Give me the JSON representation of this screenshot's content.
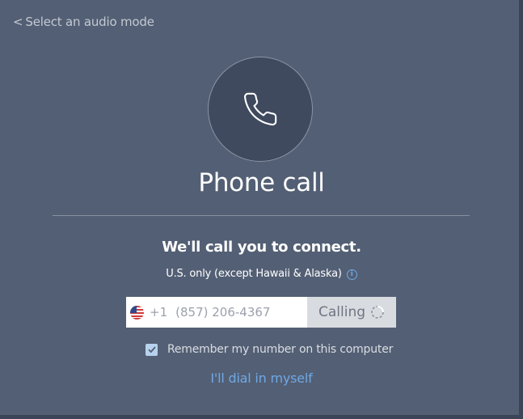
{
  "back_link": {
    "chevron": "<",
    "label": "Select an audio mode"
  },
  "hero": {
    "icon": "phone-icon",
    "title": "Phone call"
  },
  "connect": {
    "heading": "We'll call you to connect.",
    "note": "U.S. only (except Hawaii & Alaska)",
    "info_icon": "i"
  },
  "phone_input": {
    "country_flag": "us-flag-icon",
    "country_code": "+1",
    "value": "(857) 206-4367"
  },
  "calling_button": {
    "label": "Calling",
    "status": "loading"
  },
  "remember": {
    "checked": true,
    "label": "Remember my number on this computer"
  },
  "dial_link": {
    "label": "I'll dial in myself"
  },
  "colors": {
    "panel": "#535f74",
    "circle": "#3f4a5e",
    "link": "#6ea8e6",
    "button": "#d8dbe0"
  }
}
